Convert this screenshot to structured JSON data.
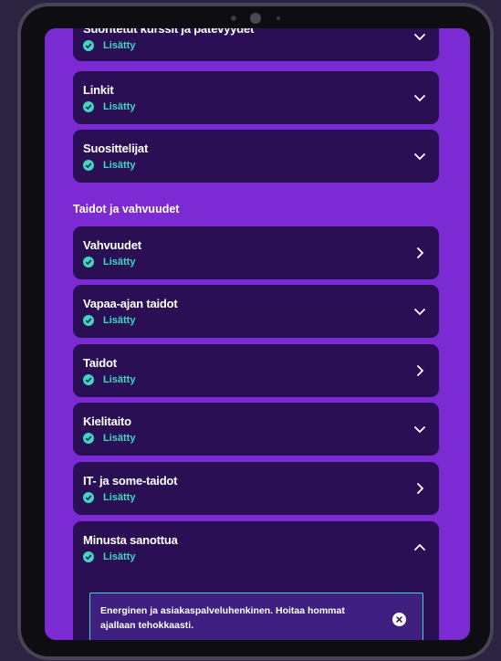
{
  "sections": {
    "skills_title": "Taidot ja vahvuudet"
  },
  "cards": [
    {
      "title": "Suoritetut kurssit ja pätevyydet",
      "status": "Lisätty",
      "chevron": "chevron-down"
    },
    {
      "title": "Linkit",
      "status": "Lisätty",
      "chevron": "chevron-down"
    },
    {
      "title": "Suosittelijat",
      "status": "Lisätty",
      "chevron": "chevron-down"
    },
    {
      "title": "Vahvuudet",
      "status": "Lisätty",
      "chevron": "chevron-right"
    },
    {
      "title": "Vapaa-ajan taidot",
      "status": "Lisätty",
      "chevron": "chevron-down"
    },
    {
      "title": "Taidot",
      "status": "Lisätty",
      "chevron": "chevron-right"
    },
    {
      "title": "Kielitaito",
      "status": "Lisätty",
      "chevron": "chevron-down"
    },
    {
      "title": "IT- ja some-taidot",
      "status": "Lisätty",
      "chevron": "chevron-right"
    },
    {
      "title": "Minusta sanottua",
      "status": "Lisätty",
      "chevron": "chevron-up"
    }
  ],
  "about_me_text": "Energinen ja asiakaspalveluhenkinen. Hoitaa hommat ajallaan tehokkaasti.",
  "colors": {
    "screen_bg": "#7c2ad4",
    "card_bg": "#2a0f55",
    "accent": "#3fd6c2"
  }
}
